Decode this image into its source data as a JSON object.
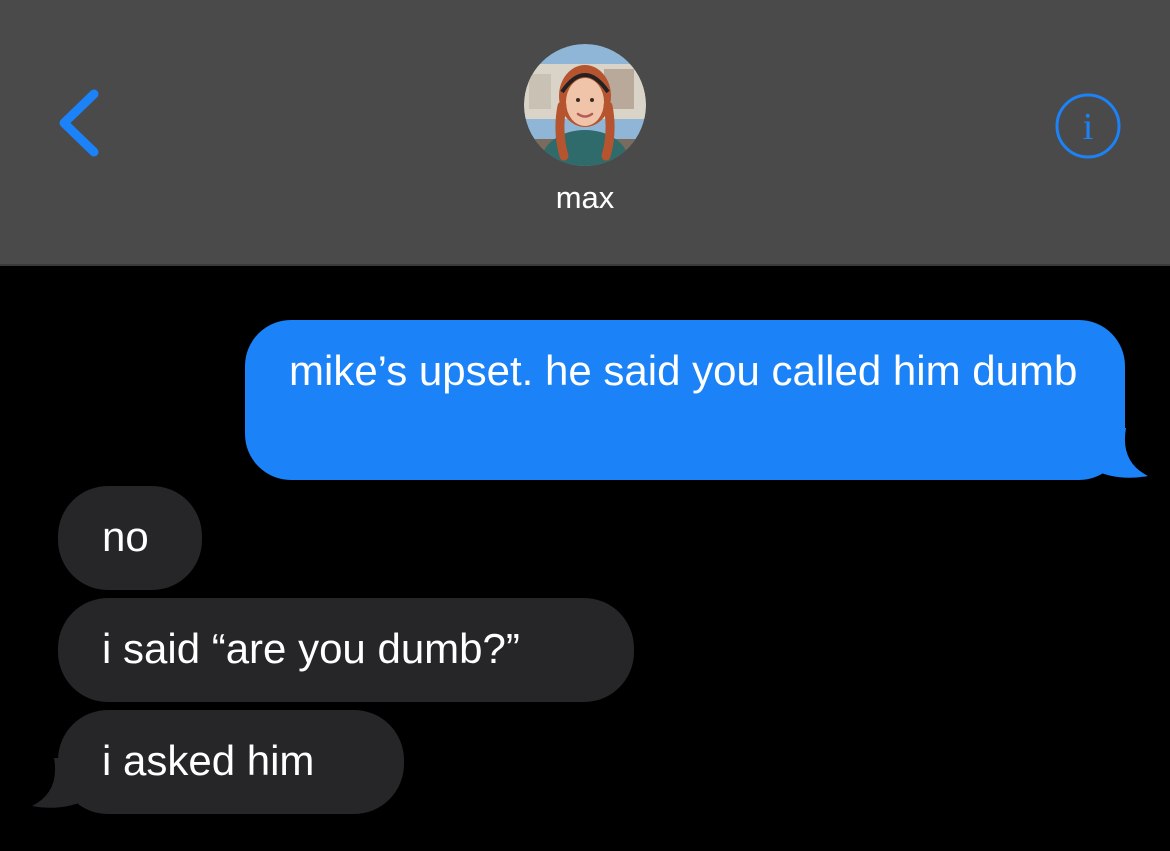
{
  "header": {
    "contact_name": "max",
    "back_icon": "chevron-left-icon",
    "info_icon": "info-icon",
    "accent_color": "#1b82f7"
  },
  "messages": [
    {
      "direction": "outgoing",
      "text": "mike’s upset. he said you called him dumb"
    },
    {
      "direction": "incoming",
      "text": "no"
    },
    {
      "direction": "incoming",
      "text": "i said “are you dumb?”"
    },
    {
      "direction": "incoming",
      "text": "i asked him"
    }
  ],
  "colors": {
    "header_bg": "#4a4a4a",
    "outgoing_bubble": "#1b82f7",
    "incoming_bubble": "#262628",
    "background": "#000000"
  }
}
